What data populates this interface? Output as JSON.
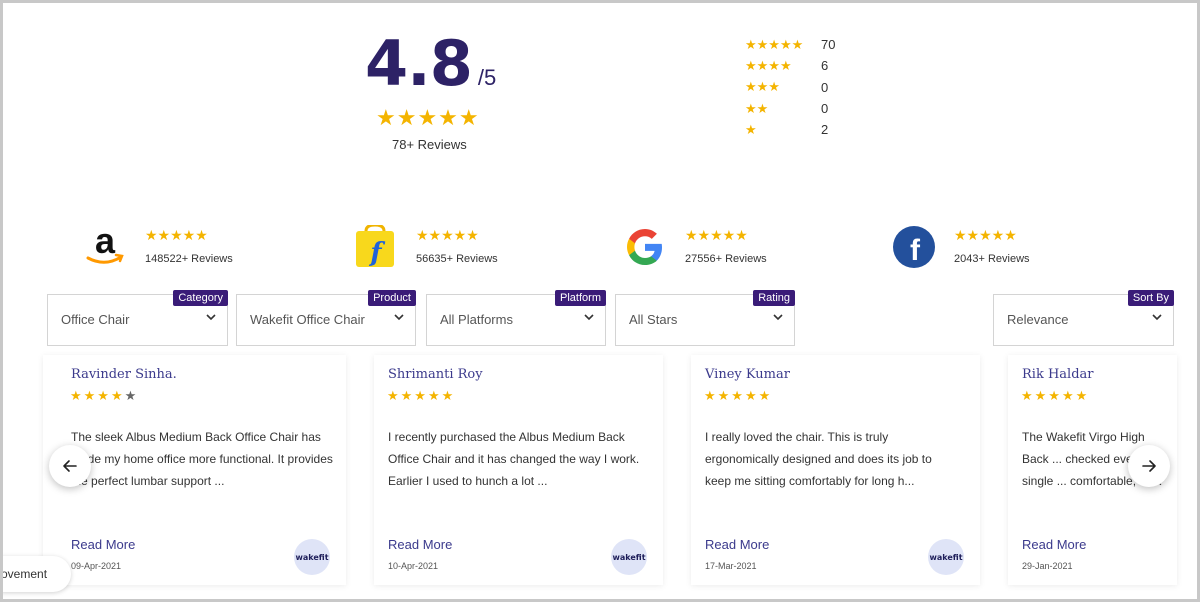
{
  "summary": {
    "score": "4.8",
    "score_denominator": "/5",
    "stars": "★★★★★",
    "reviews_label": "78+ Reviews"
  },
  "breakdown": [
    {
      "stars": "★★★★★",
      "count": "70"
    },
    {
      "stars": "★★★★",
      "count": "6"
    },
    {
      "stars": "★★★",
      "count": "0"
    },
    {
      "stars": "★★",
      "count": "0"
    },
    {
      "stars": "★",
      "count": "2"
    }
  ],
  "platforms": [
    {
      "name": "amazon",
      "icon": "amazon-logo",
      "stars": "★★★★★",
      "reviews": "148522+ Reviews"
    },
    {
      "name": "flipkart",
      "icon": "flipkart-logo",
      "stars": "★★★★★",
      "reviews": "56635+ Reviews"
    },
    {
      "name": "google",
      "icon": "google-logo",
      "stars": "★★★★★",
      "reviews": "27556+ Reviews"
    },
    {
      "name": "facebook",
      "icon": "facebook-logo",
      "stars": "★★★★★",
      "reviews": "2043+ Reviews"
    }
  ],
  "filters": {
    "category": {
      "tag": "Category",
      "value": "Office Chair"
    },
    "product": {
      "tag": "Product",
      "value": "Wakefit Office Chair"
    },
    "platform": {
      "tag": "Platform",
      "value": "All Platforms"
    },
    "rating": {
      "tag": "Rating",
      "value": "All Stars"
    },
    "sort": {
      "tag": "Sort By",
      "value": "Relevance"
    }
  },
  "reviews": [
    {
      "name": "Ravinder Sinha.",
      "stars_filled": "★★★★",
      "stars_empty": "★",
      "text": "The sleek Albus Medium Back Office Chair has made my home office more functional. It provides the perfect lumbar support ...",
      "read_more": "Read More",
      "date": "09-Apr-2021",
      "badge": "wakefit"
    },
    {
      "name": "Shrimanti Roy",
      "stars_filled": "★★★★★",
      "stars_empty": "",
      "text": "I recently purchased the Albus Medium Back Office Chair and it has changed the way I work. Earlier I used to hunch a lot ...",
      "read_more": "Read More",
      "date": "10-Apr-2021",
      "badge": "wakefit"
    },
    {
      "name": "Viney Kumar",
      "stars_filled": "★★★★★",
      "stars_empty": "",
      "text": "I really loved the chair. This is truly ergonomically designed and does its job to keep me sitting comfortably for long h...",
      "read_more": "Read More",
      "date": "17-Mar-2021",
      "badge": "wakefit"
    },
    {
      "name": "Rik Haldar",
      "stars_filled": "★★★★★",
      "stars_empty": "",
      "text": "The Wakefit Virgo High Back ... checked every single ... comfortable, look gr...",
      "read_more": "Read More",
      "date": "29-Jan-2021",
      "badge": "wakefit"
    }
  ],
  "nav": {
    "prev_icon": "arrow-left-icon",
    "next_icon": "arrow-right-icon"
  },
  "floating_tab": {
    "label": "ovement"
  },
  "colors": {
    "brand_purple": "#2d2266",
    "tag_purple": "#3a1c78",
    "star_gold": "#f4b400",
    "link_blue": "#3b3a8c"
  }
}
